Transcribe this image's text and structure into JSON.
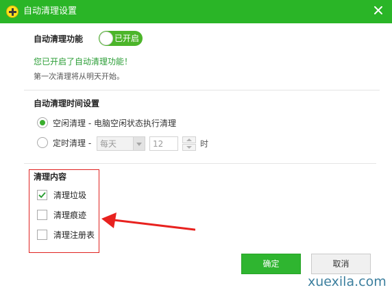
{
  "window": {
    "title": "自动清理设置",
    "title_bar_color": "#2ab527",
    "close_icon": "close-icon",
    "logo_icon": "plus-logo-icon"
  },
  "auto_clean": {
    "label": "自动清理功能",
    "toggle_text": "已开启",
    "toggle_on": true,
    "status_message": "您已开启了自动清理功能！",
    "start_note": "第一次清理将从明天开始。"
  },
  "schedule": {
    "title": "自动清理时间设置",
    "options": [
      {
        "label": "空闲清理 - 电脑空闲状态执行清理",
        "selected": true
      },
      {
        "label": "定时清理 -",
        "selected": false
      }
    ],
    "frequency_value": "每天",
    "hour_value": "12",
    "hour_unit": "时"
  },
  "contents": {
    "title": "清理内容",
    "items": [
      {
        "label": "清理垃圾",
        "checked": true
      },
      {
        "label": "清理痕迹",
        "checked": false
      },
      {
        "label": "清理注册表",
        "checked": false
      }
    ],
    "highlight_color": "#e0201e"
  },
  "buttons": {
    "ok": "确定",
    "cancel": "取消",
    "ok_color": "#2fb530"
  },
  "watermark": "xuexila.com"
}
